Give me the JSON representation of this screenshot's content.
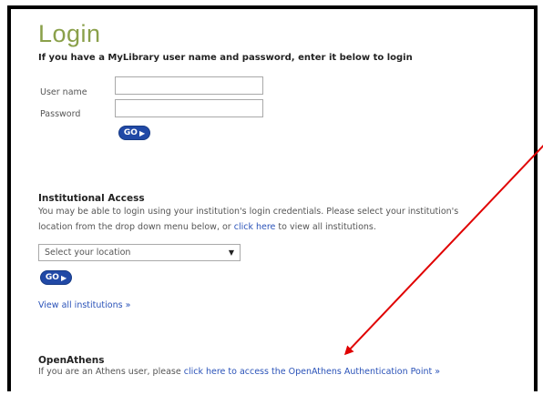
{
  "login": {
    "title": "Login",
    "subtitle": "If you have a MyLibrary user name and password, enter it below to login",
    "username_label": "User name",
    "password_label": "Password",
    "username_value": "",
    "password_value": "",
    "go_label": "GO"
  },
  "institutional": {
    "title": "Institutional Access",
    "text_line1": "You may be able to login using your institution's login credentials. Please select your institution's",
    "text_line2_a": "location from the drop down menu below, or ",
    "text_line2_link": "click here",
    "text_line2_b": " to view all institutions.",
    "select_value": "Select your location",
    "go_label": "GO",
    "view_all": "View all institutions »"
  },
  "openathens": {
    "title": "OpenAthens",
    "text_a": "If you are an Athens user, please ",
    "text_link": "click here to access the OpenAthens Authentication Point »"
  },
  "colors": {
    "title_green": "#8aa04a",
    "button_blue": "#2149a6",
    "link_blue": "#2a52b8",
    "annotation_red": "#e00000"
  }
}
